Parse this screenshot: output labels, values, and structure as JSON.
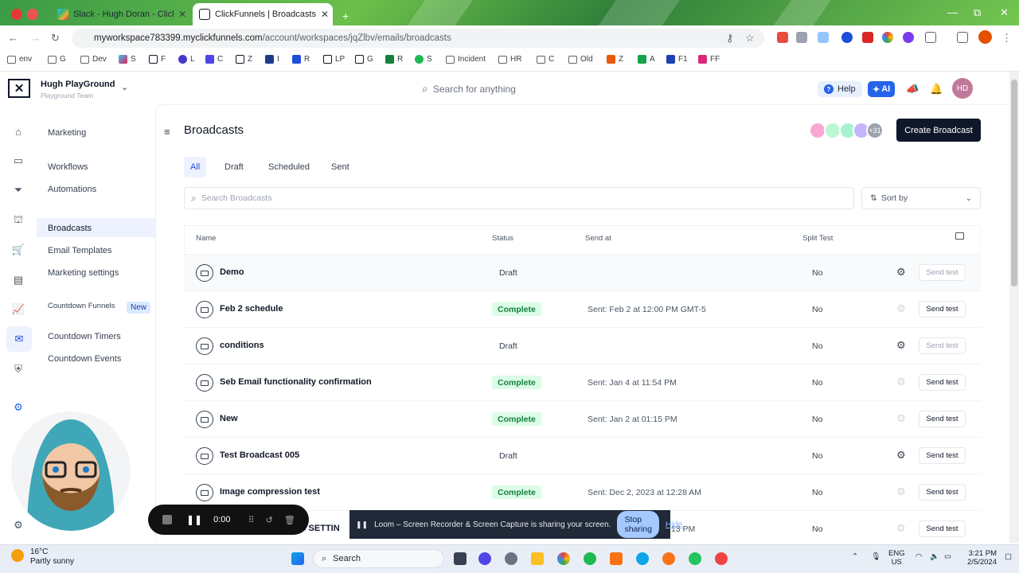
{
  "browser": {
    "tabs": [
      {
        "title": "Slack - Hugh Doran - ClickFunnels",
        "active": false
      },
      {
        "title": "ClickFunnels | Broadcasts",
        "active": true
      }
    ],
    "url_host": "myworkspace783399.myclickfunnels.com",
    "url_path": "/account/workspaces/jqZlbv/emails/broadcasts",
    "bookmarks": [
      "env",
      "G",
      "Dev",
      "S",
      "F",
      "L",
      "C",
      "Z",
      "I",
      "R",
      "LP",
      "G",
      "R",
      "S",
      "Incident",
      "HR",
      "C",
      "Old",
      "Z",
      "A",
      "F1",
      "FF"
    ]
  },
  "workspace": {
    "name": "Hugh PlayGround",
    "team": "Playground Team"
  },
  "top": {
    "search_placeholder": "Search for anything",
    "help": "Help",
    "ai": "AI",
    "avatar_initials": "HD"
  },
  "sidebar": {
    "section": "Marketing",
    "items": [
      "Workflows",
      "Automations",
      "Broadcasts",
      "Email Templates",
      "Marketing settings",
      "Countdown Funnels",
      "Countdown Timers",
      "Countdown Events"
    ],
    "new_badge": "New"
  },
  "page": {
    "title": "Broadcasts",
    "collab_more": "+31",
    "create_button": "Create Broadcast",
    "tabs": [
      "All",
      "Draft",
      "Scheduled",
      "Sent"
    ],
    "search_placeholder": "Search Broadcasts",
    "sort_label": "Sort by"
  },
  "table": {
    "headers": [
      "Name",
      "Status",
      "Send at",
      "Split Test"
    ],
    "rows": [
      {
        "name": "Demo",
        "status": "Draft",
        "send_at": "",
        "split": "No",
        "send_test": "Send test"
      },
      {
        "name": "Feb 2 schedule",
        "status": "Complete",
        "send_at": "Sent: Feb 2 at 12:00 PM GMT-5",
        "split": "No",
        "send_test": "Send test"
      },
      {
        "name": "conditions",
        "status": "Draft",
        "send_at": "",
        "split": "No",
        "send_test": "Send test"
      },
      {
        "name": "Seb Email functionality confirmation",
        "status": "Complete",
        "send_at": "Sent: Jan 4 at 11:54 PM",
        "split": "No",
        "send_test": "Send test"
      },
      {
        "name": "New",
        "status": "Complete",
        "send_at": "Sent: Jan 2 at 01:15 PM",
        "split": "No",
        "send_test": "Send test"
      },
      {
        "name": "Test Broadcast 005",
        "status": "Draft",
        "send_at": "",
        "split": "No",
        "send_test": "Send test"
      },
      {
        "name": "Image compression test",
        "status": "Complete",
        "send_at": "Sent: Dec 2, 2023 at 12:28 AM",
        "split": "No",
        "send_test": "Send test"
      },
      {
        "name": "NG SETTIN",
        "status": "",
        "send_at": ":13 PM",
        "split": "No",
        "send_test": "Send test"
      }
    ]
  },
  "loom": {
    "timer": "0:00",
    "share_text": "Loom – Screen Recorder & Screen Capture is sharing your screen.",
    "stop": "Stop sharing",
    "hide": "Hide"
  },
  "taskbar": {
    "temp": "16°C",
    "weather": "Partly sunny",
    "search": "Search",
    "lang": "ENG",
    "region": "US",
    "time": "3:21 PM",
    "date": "2/5/2024"
  },
  "colors": {
    "accent": "#2563eb",
    "create_bg": "#0f172a",
    "complete_bg": "#dcfce7",
    "complete_fg": "#15803d"
  }
}
